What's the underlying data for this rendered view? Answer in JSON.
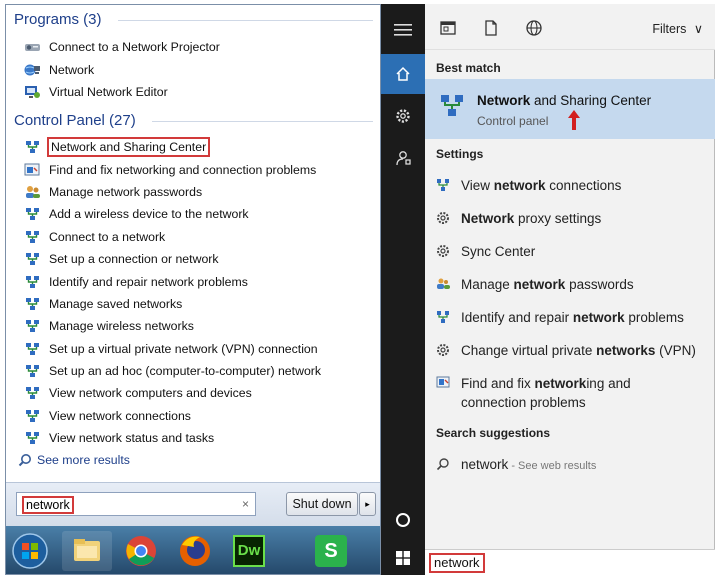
{
  "win7": {
    "programs_heading": "Programs (3)",
    "programs": [
      {
        "label": "Connect to a Network Projector",
        "icon": "projector-icon"
      },
      {
        "label": "Network",
        "icon": "network-globe-icon"
      },
      {
        "label": "Virtual Network Editor",
        "icon": "vmware-icon"
      }
    ],
    "control_panel_heading": "Control Panel (27)",
    "control_panel": [
      {
        "label": "Network and Sharing Center",
        "icon": "network-icon",
        "highlighted": true
      },
      {
        "label": "Find and fix networking and connection problems",
        "icon": "troubleshoot-icon"
      },
      {
        "label": "Manage network passwords",
        "icon": "users-icon"
      },
      {
        "label": "Add a wireless device to the network",
        "icon": "network-icon"
      },
      {
        "label": "Connect to a network",
        "icon": "network-icon"
      },
      {
        "label": "Set up a connection or network",
        "icon": "network-icon"
      },
      {
        "label": "Identify and repair network problems",
        "icon": "network-icon"
      },
      {
        "label": "Manage saved networks",
        "icon": "network-icon"
      },
      {
        "label": "Manage wireless networks",
        "icon": "network-icon"
      },
      {
        "label": "Set up a virtual private network (VPN) connection",
        "icon": "network-icon"
      },
      {
        "label": "Set up an ad hoc (computer-to-computer) network",
        "icon": "network-icon"
      },
      {
        "label": "View network computers and devices",
        "icon": "network-icon"
      },
      {
        "label": "View network connections",
        "icon": "network-icon"
      },
      {
        "label": "View network status and tasks",
        "icon": "network-icon"
      }
    ],
    "see_more": "See more results",
    "search_value": "network",
    "clear_glyph": "×",
    "shutdown_label": "Shut down",
    "shutdown_arrow": "▸",
    "taskbar": [
      "start-orb-icon",
      "explorer-icon",
      "chrome-icon",
      "firefox-icon",
      "dreamweaver-icon",
      "app-s-icon"
    ],
    "dw_label": "Dw",
    "s_label": "S"
  },
  "win10": {
    "filters_label": "Filters",
    "filters_chevron": "∨",
    "best_match_heading": "Best match",
    "best_match": {
      "title_bold": "Network",
      "title_rest": " and Sharing Center",
      "subtitle": "Control panel"
    },
    "settings_heading": "Settings",
    "settings": [
      {
        "pre": "View ",
        "bold": "network",
        "post": " connections",
        "icon": "network-icon"
      },
      {
        "pre": "",
        "bold": "Network",
        "post": " proxy settings",
        "icon": "gear-icon"
      },
      {
        "pre": "Sync Center",
        "bold": "",
        "post": "",
        "icon": "gear-icon"
      },
      {
        "pre": "Manage ",
        "bold": "network",
        "post": " passwords",
        "icon": "users-icon"
      },
      {
        "pre": "Identify and repair ",
        "bold": "network",
        "post": " problems",
        "icon": "network-icon"
      },
      {
        "pre": "Change virtual private ",
        "bold": "networks",
        "post": " (VPN)",
        "icon": "gear-icon"
      },
      {
        "pre": "Find and fix ",
        "bold": "network",
        "post": "ing and connection problems",
        "icon": "troubleshoot-icon"
      }
    ],
    "suggestions_heading": "Search suggestions",
    "suggestion": {
      "text": "network",
      "hint": " - See web results"
    },
    "search_value": "network"
  },
  "accent": {
    "red_box": "#d23a3a",
    "win10_blue": "#2c6fb4",
    "best_match_bg": "#c5d9ee"
  }
}
